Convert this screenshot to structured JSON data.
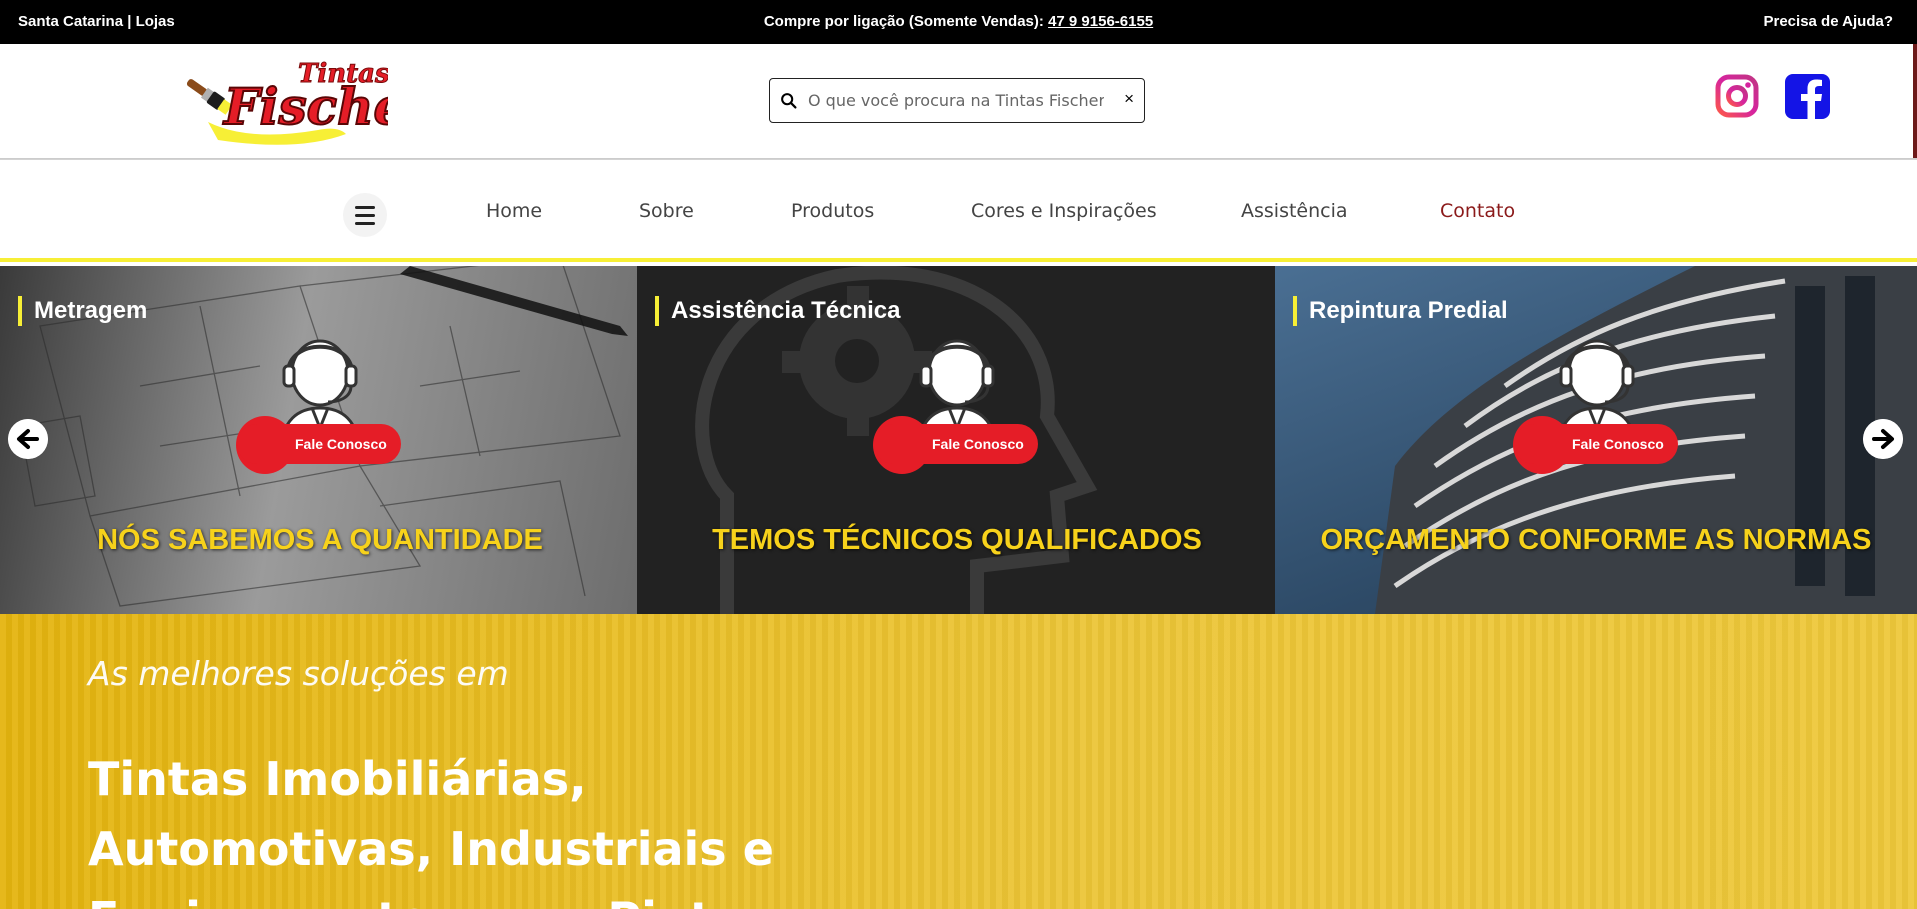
{
  "topbar": {
    "left": "Santa Catarina | Lojas",
    "center_label": "Compre por ligação (Somente Vendas):",
    "phone": "47 9 9156-6155",
    "right": "Precisa de Ajuda?"
  },
  "header": {
    "logo_small": "Tintas",
    "logo_big": "Fischer",
    "search_placeholder": "O que você procura na Tintas Fischer?",
    "clear": "×"
  },
  "nav": {
    "items": [
      {
        "label": "Home"
      },
      {
        "label": "Sobre"
      },
      {
        "label": "Produtos"
      },
      {
        "label": "Cores e Inspirações"
      },
      {
        "label": "Assistência"
      },
      {
        "label": "Contato"
      }
    ],
    "active_color": "#8b1a1a"
  },
  "carousel": {
    "slides": [
      {
        "title": "Metragem",
        "button": "Fale Conosco",
        "headline": "NÓS SABEMOS A QUANTIDADE"
      },
      {
        "title": "Assistência Técnica",
        "button": "Fale Conosco",
        "headline": "TEMOS TÉCNICOS QUALIFICADOS"
      },
      {
        "title": "Repintura Predial",
        "button": "Fale Conosco",
        "headline": "ORÇAMENTO CONFORME AS NORMAS"
      }
    ]
  },
  "hero": {
    "subtitle": "As melhores soluções em",
    "title": "Tintas Imobiliárias, Automotivas, Industriais e Equipamentos para Pintura"
  },
  "colors": {
    "accent_yellow": "#f7ef36",
    "brand_red": "#e51d27",
    "hero_yellow": "#e8bd22"
  }
}
